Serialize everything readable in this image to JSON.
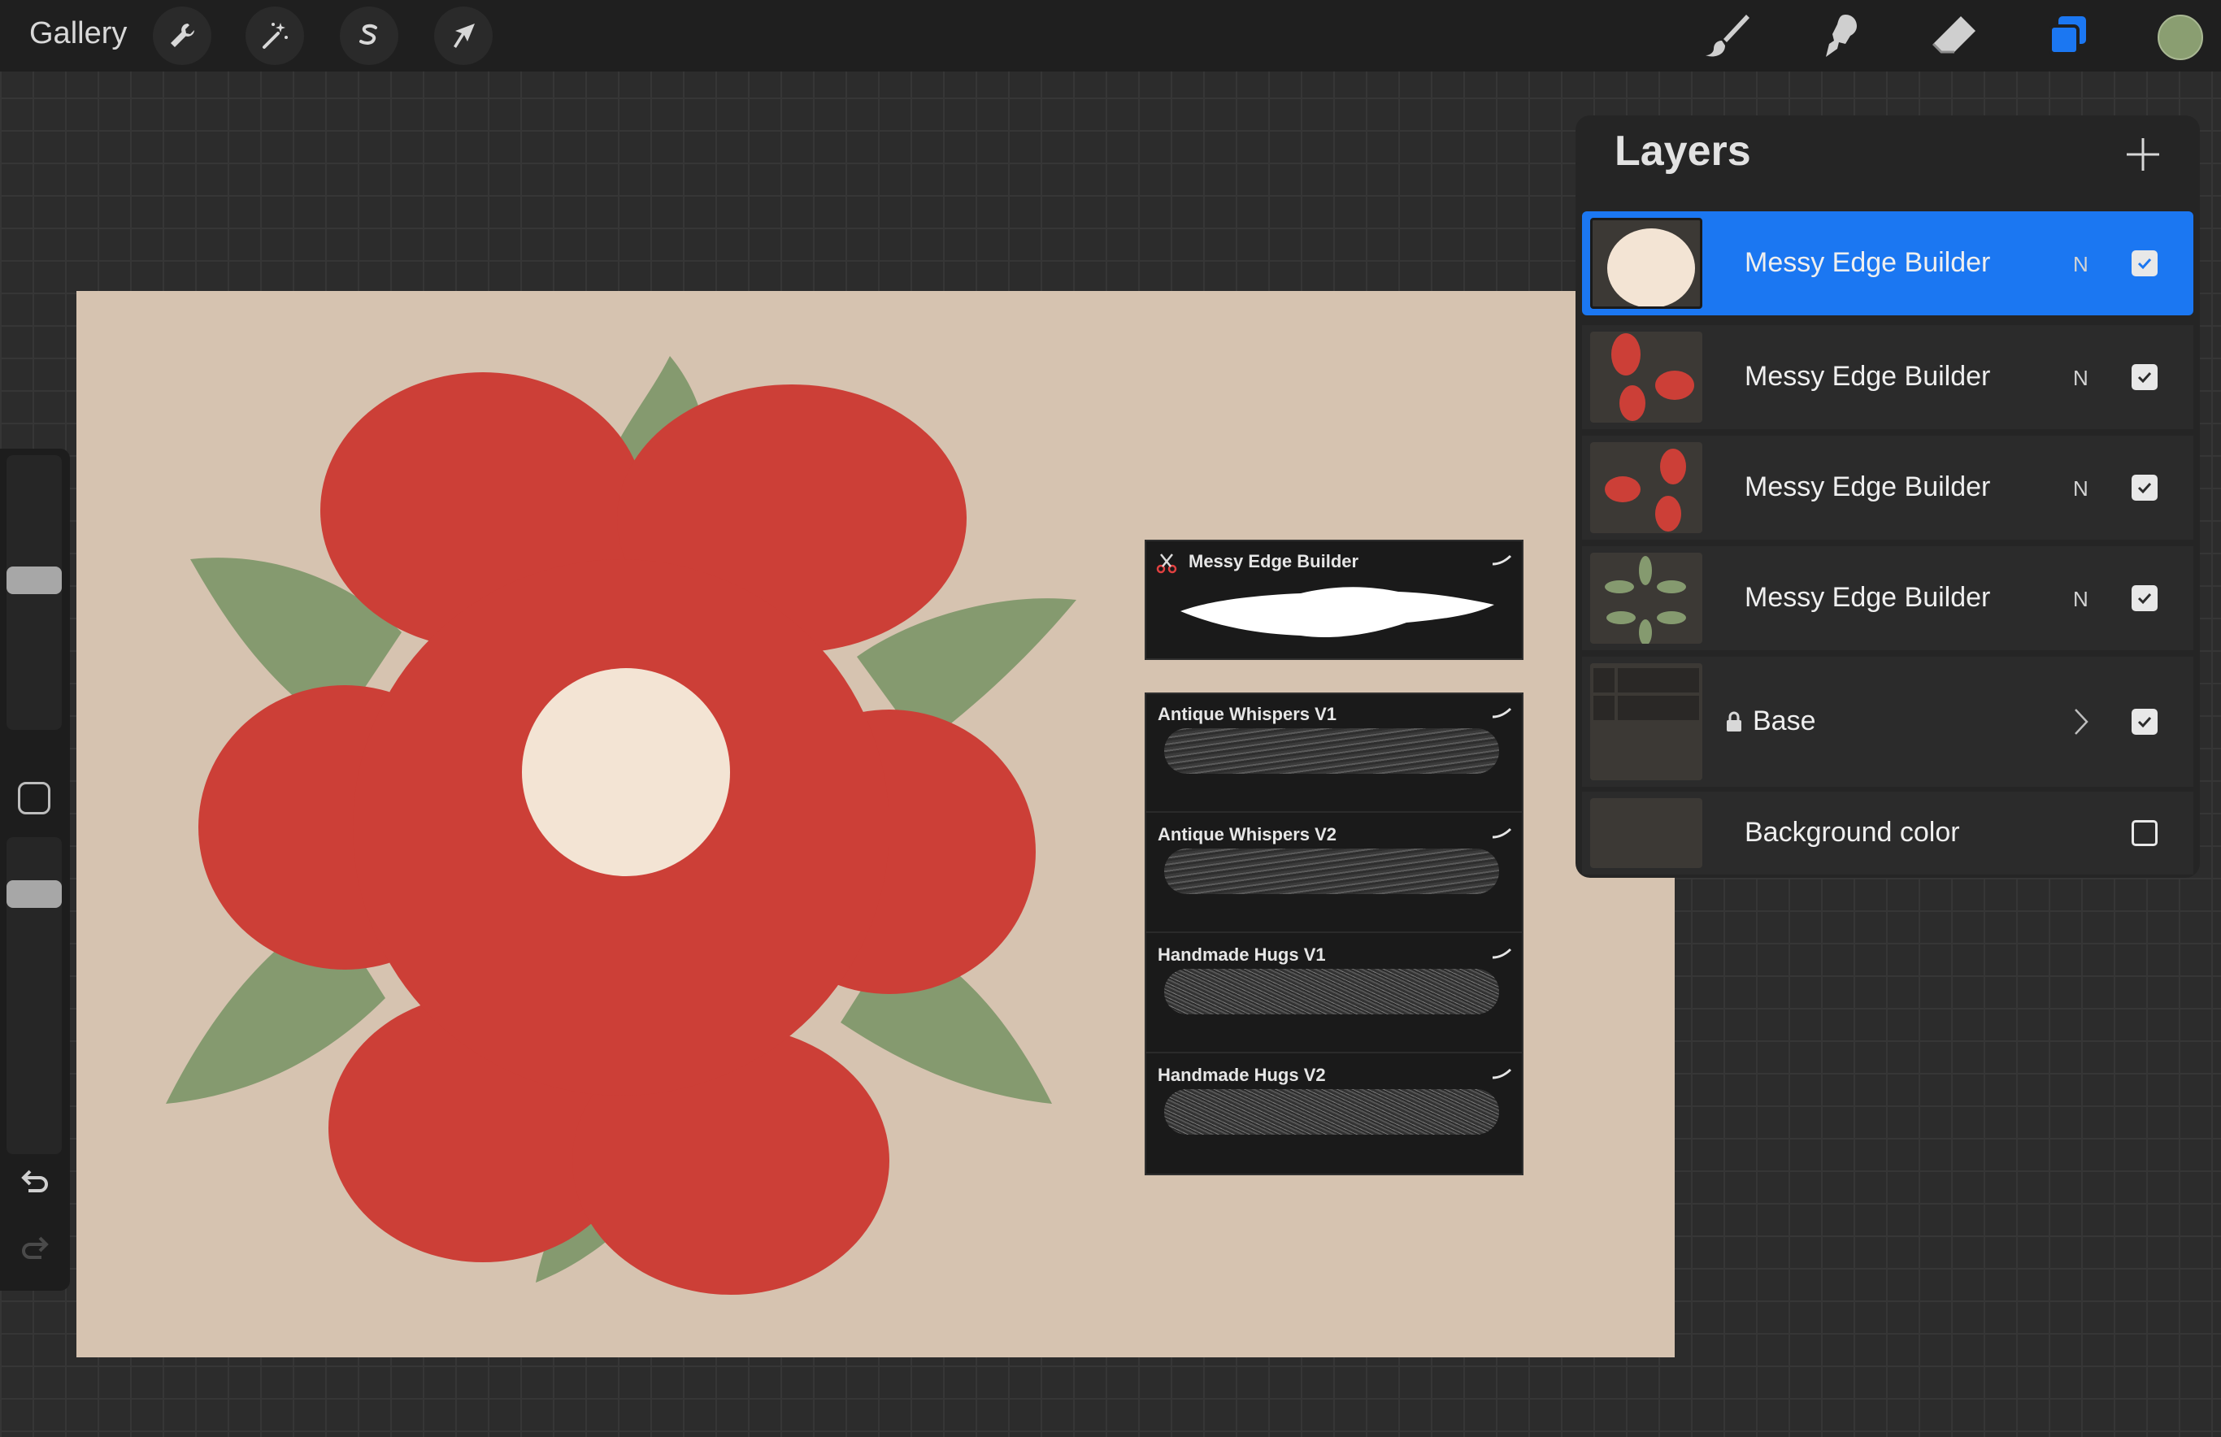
{
  "app": {
    "gallery_label": "Gallery"
  },
  "toolbar": {
    "left_tools": [
      "wrench-icon",
      "magic-wand-icon",
      "selection-icon",
      "transform-arrow-icon"
    ],
    "right_tools": [
      "brush-icon",
      "smudge-icon",
      "eraser-icon",
      "layers-icon"
    ],
    "active_tool": "layers-icon",
    "accent_color": "#1b77f2",
    "current_color": "#8a9e71"
  },
  "sidebar": {
    "brush_size_level": 0.55,
    "opacity_level": 0.85
  },
  "canvas": {
    "background": "#d6c3b0",
    "petal_color": "#cc3f37",
    "leaf_color": "#859a6f",
    "center_color": "#f3e4d4"
  },
  "brush_cards": {
    "header": {
      "title": "Messy Edge Builder"
    },
    "list": [
      {
        "title": "Antique Whispers V1"
      },
      {
        "title": "Antique Whispers V2"
      },
      {
        "title": "Handmade Hugs V1"
      },
      {
        "title": "Handmade Hugs V2"
      }
    ]
  },
  "layers_panel": {
    "title": "Layers",
    "layers": [
      {
        "name": "Messy Edge Builder",
        "mode": "N",
        "visible": true,
        "selected": true,
        "thumb": "center"
      },
      {
        "name": "Messy Edge Builder",
        "mode": "N",
        "visible": true,
        "selected": false,
        "thumb": "petals-a"
      },
      {
        "name": "Messy Edge Builder",
        "mode": "N",
        "visible": true,
        "selected": false,
        "thumb": "petals-b"
      },
      {
        "name": "Messy Edge Builder",
        "mode": "N",
        "visible": true,
        "selected": false,
        "thumb": "leaves"
      },
      {
        "name": "Base",
        "mode": "",
        "visible": true,
        "selected": false,
        "thumb": "group",
        "locked": true
      },
      {
        "name": "Background color",
        "mode": "",
        "visible": false,
        "selected": false,
        "thumb": "bg"
      }
    ]
  }
}
